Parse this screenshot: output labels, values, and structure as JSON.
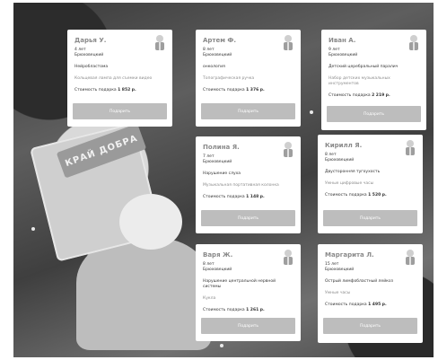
{
  "background": {
    "banner_text": "КРАЙ ДОБРА"
  },
  "cards": [
    {
      "name": "Дарья У.",
      "age": "4 лет",
      "city": "Брюховецкий",
      "diagnosis": "Нейробластома",
      "gift": "Кольцевая лампа для съемки видео",
      "cost_label": "Стоимость подарка",
      "cost_value": "1 852 р.",
      "button": "Подарить",
      "icon": "santa-gift-icon"
    },
    {
      "name": "Артем Ф.",
      "age": "8 лет",
      "city": "Брюховецкий",
      "diagnosis": "онкология",
      "gift": "Топографическая ручка",
      "cost_label": "Стоимость подарка",
      "cost_value": "1 376 р.",
      "button": "Подарить",
      "icon": "santa-gift-icon"
    },
    {
      "name": "Иван А.",
      "age": "9 лет",
      "city": "Брюховецкий",
      "diagnosis": "Детский церебральный паралич",
      "gift": "Набор детских музыкальных инструментов",
      "cost_label": "Стоимость подарка",
      "cost_value": "2 219 р.",
      "button": "Подарить",
      "icon": "santa-gift-icon"
    },
    {
      "name": "Полина Я.",
      "age": "7 лет",
      "city": "Брюховецкий",
      "diagnosis": "Нарушение слуха",
      "gift": "Музыкальная портативная колонка",
      "cost_label": "Стоимость подарка",
      "cost_value": "1 148 р.",
      "button": "Подарить",
      "icon": "santa-gift-icon"
    },
    {
      "name": "Кирилл Я.",
      "age": "8 лет",
      "city": "Брюховецкий",
      "diagnosis": "Двусторонняя тугоухость",
      "gift": "Умные цифровые часы",
      "cost_label": "Стоимость подарка",
      "cost_value": "1 520 р.",
      "button": "Подарить",
      "icon": "santa-gift-icon"
    },
    {
      "name": "Варя Ж.",
      "age": "8 лет",
      "city": "Брюховецкий",
      "diagnosis": "Нарушение центральной нервной системы",
      "gift": "Кукла",
      "cost_label": "Стоимость подарка",
      "cost_value": "1 261 р.",
      "button": "Подарить",
      "icon": "santa-gift-icon"
    },
    {
      "name": "Маргарита Л.",
      "age": "15 лет",
      "city": "Брюховецкий",
      "diagnosis": "Острый лимфобластный лейкоз",
      "gift": "Умные часы",
      "cost_label": "Стоимость подарка",
      "cost_value": "1 495 р.",
      "button": "Подарить",
      "icon": "santa-gift-icon"
    }
  ]
}
